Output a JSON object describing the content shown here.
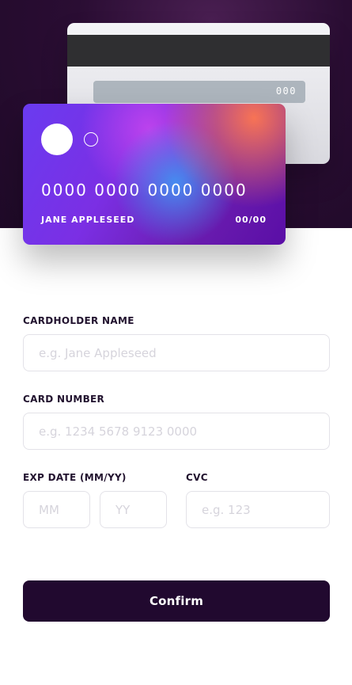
{
  "card_back": {
    "cvc": "000"
  },
  "card_front": {
    "number": "0000 0000 0000 0000",
    "name": "JANE APPLESEED",
    "expiry": "00/00"
  },
  "form": {
    "cardholder_label": "CARDHOLDER NAME",
    "cardholder_placeholder": "e.g. Jane Appleseed",
    "cardholder_value": "",
    "number_label": "CARD NUMBER",
    "number_placeholder": "e.g. 1234 5678 9123 0000",
    "number_value": "",
    "exp_label": "EXP DATE (MM/YY)",
    "mm_placeholder": "MM",
    "yy_placeholder": "YY",
    "cvc_label": "CVC",
    "cvc_placeholder": "e.g. 123",
    "confirm_label": "Confirm"
  },
  "colors": {
    "hero_bg": "#1f0a28",
    "button_bg": "#21092f",
    "input_border": "#e3e2e8",
    "placeholder": "#d6d4dc"
  }
}
